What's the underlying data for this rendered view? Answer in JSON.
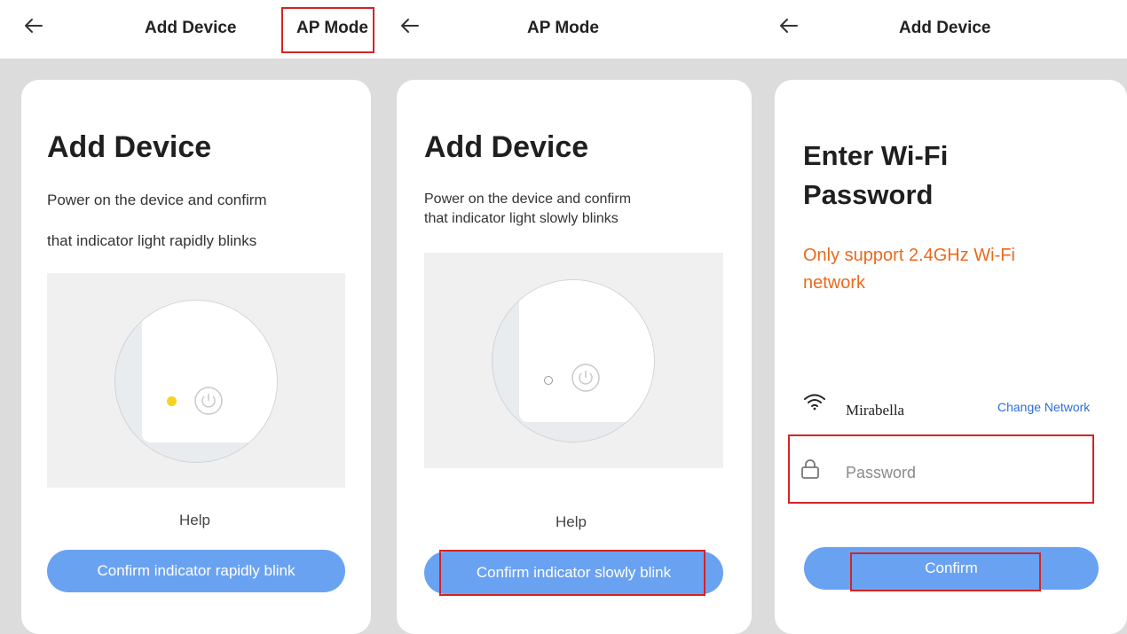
{
  "screen1": {
    "back_icon": "arrow-left-icon",
    "header_title": "Add Device",
    "header_action": "AP Mode",
    "heading": "Add Device",
    "desc_line1": "Power on the device and confirm",
    "desc_line2": "that indicator light rapidly blinks",
    "indicator_color": "#f5d321",
    "help": "Help",
    "confirm_button": "Confirm indicator rapidly blink"
  },
  "screen2": {
    "back_icon": "arrow-left-icon",
    "header_title": "AP Mode",
    "heading": "Add Device",
    "desc_line1": "Power on the device and confirm",
    "desc_line2": "that indicator light slowly blinks",
    "help": "Help",
    "confirm_button": "Confirm indicator slowly blink"
  },
  "screen3": {
    "back_icon": "arrow-left-icon",
    "header_title": "Add Device",
    "heading_line1": "Enter Wi-Fi",
    "heading_line2": "Password",
    "warning_line1": "Only support 2.4GHz Wi-Fi",
    "warning_line2": "network",
    "wifi_icon": "wifi-icon",
    "network_name": "Mirabella",
    "change_network": "Change Network",
    "lock_icon": "lock-icon",
    "password_placeholder": "Password",
    "confirm_button": "Confirm"
  },
  "colors": {
    "button_blue": "#6aa2f2",
    "highlight_red": "#d32424",
    "warning_orange": "#ea6a1d",
    "link_blue": "#2e6fd8"
  }
}
